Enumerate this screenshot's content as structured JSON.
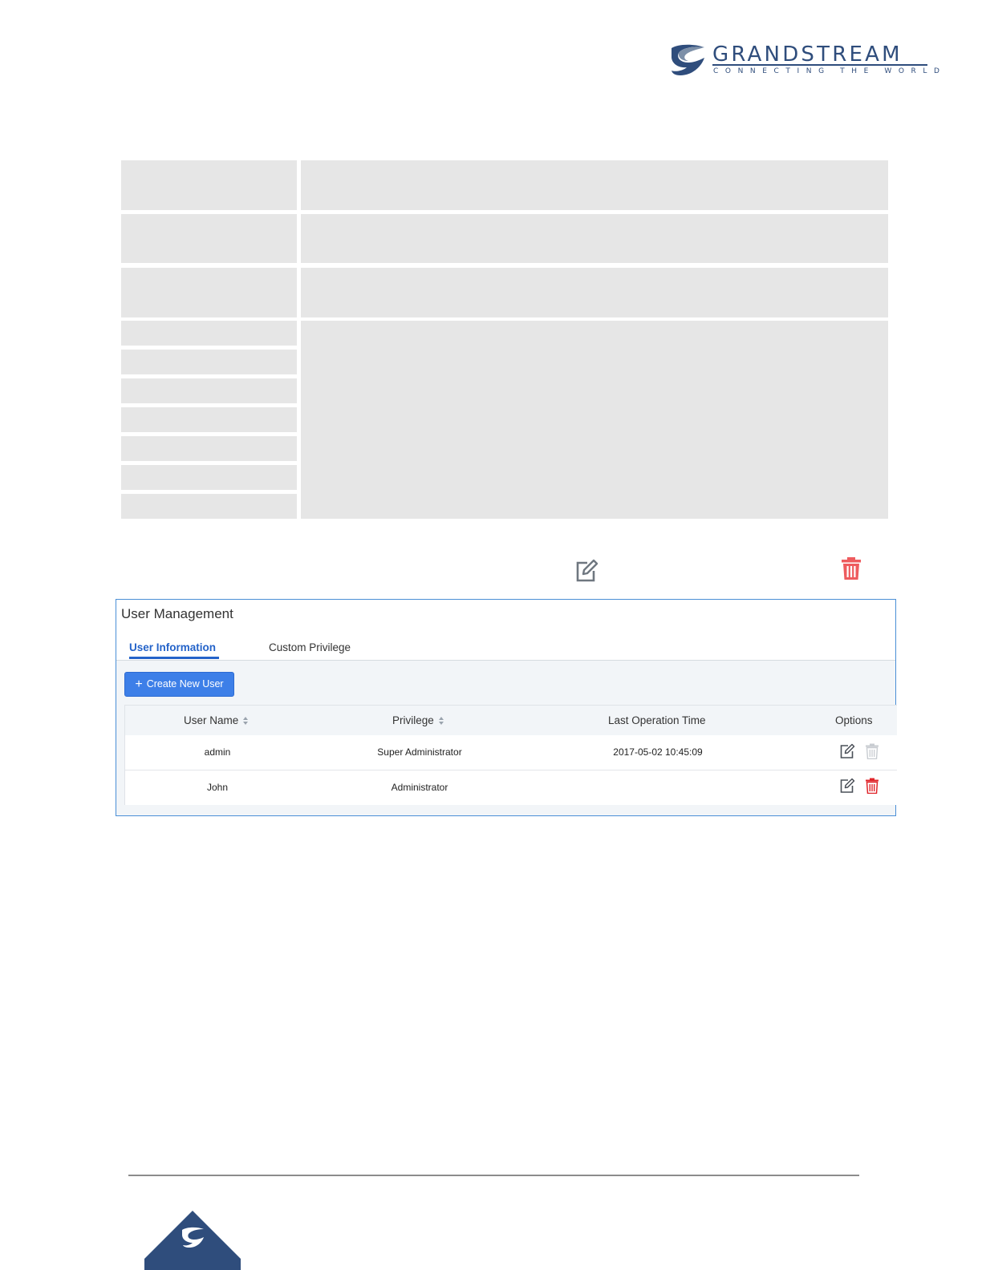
{
  "header": {
    "logo_word": "GRANDSTREAM",
    "logo_tagline": "CONNECTING THE WORLD"
  },
  "panel": {
    "title": "User Management",
    "tabs": [
      {
        "label": "User Information",
        "active": true
      },
      {
        "label": "Custom Privilege",
        "active": false
      }
    ],
    "create_button_label": "Create New User",
    "table": {
      "columns": [
        "User Name",
        "Privilege",
        "Last Operation Time",
        "Options"
      ],
      "rows": [
        {
          "user_name": "admin",
          "privilege": "Super Administrator",
          "last_operation_time": "2017-05-02 10:45:09",
          "delete_enabled": false
        },
        {
          "user_name": "John",
          "privilege": "Administrator",
          "last_operation_time": "",
          "delete_enabled": true
        }
      ]
    }
  },
  "icons": {
    "edit": "edit-icon",
    "delete": "trash-icon",
    "sort": "sort-icon"
  },
  "colors": {
    "brand": "#2f4d7c",
    "accent": "#3d7fe8",
    "tab_active": "#2463c9",
    "delete": "#e0252a",
    "delete_disabled": "#c8ccd1",
    "panel_border": "#4a8fd6"
  }
}
